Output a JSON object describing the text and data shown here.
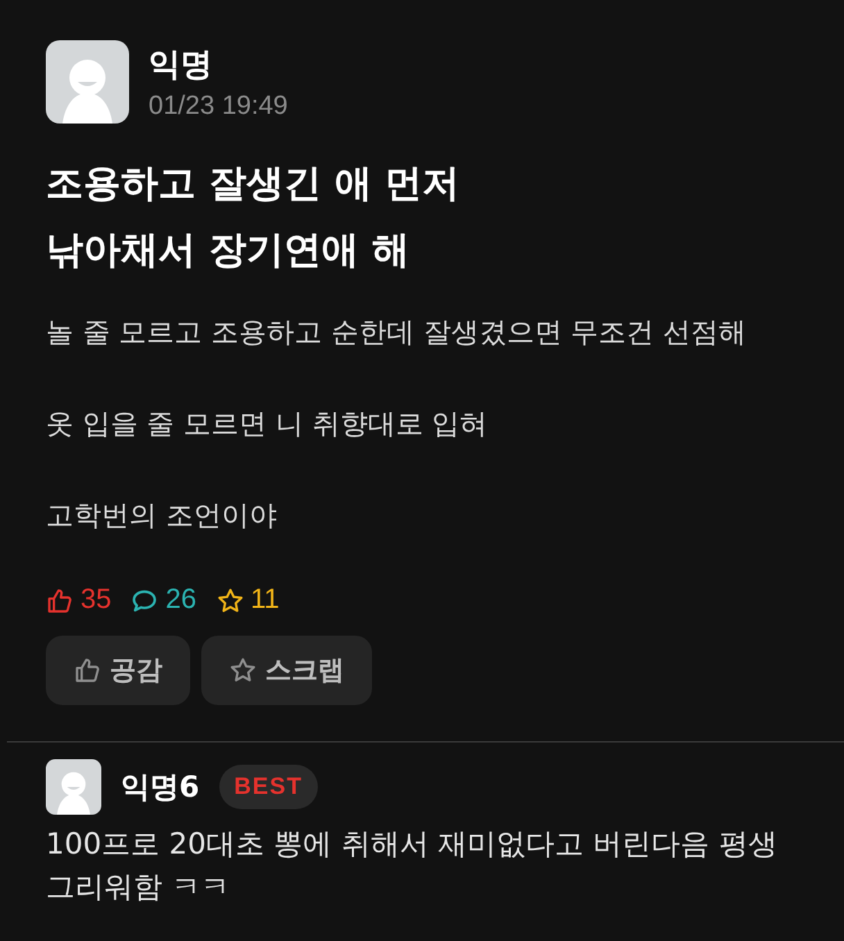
{
  "post": {
    "author": "익명",
    "time": "01/23 19:49",
    "title": "조용하고 잘생긴 애 먼저\n낚아채서 장기연애 해",
    "paragraphs": [
      "놀 줄 모르고 조용하고 순한데 잘생겼으면 무조건 선점해",
      "옷 입을 줄 모르면 니 취향대로 입혀",
      "고학번의 조언이야"
    ],
    "stats": [
      {
        "kind": "likes",
        "count": "35",
        "color": "#e5322d"
      },
      {
        "kind": "comments",
        "count": "26",
        "color": "#2bb3b1"
      },
      {
        "kind": "scraps",
        "count": "11",
        "color": "#f1b418"
      }
    ],
    "buttons": [
      {
        "kind": "like",
        "label": "공감"
      },
      {
        "kind": "scrap",
        "label": "스크랩"
      }
    ]
  },
  "comments": [
    {
      "author": "익명6",
      "badge": "BEST",
      "text": "100프로 20대초 뽕에 취해서 재미없다고 버린다음 평생 그리워함 ㅋㅋ"
    }
  ]
}
